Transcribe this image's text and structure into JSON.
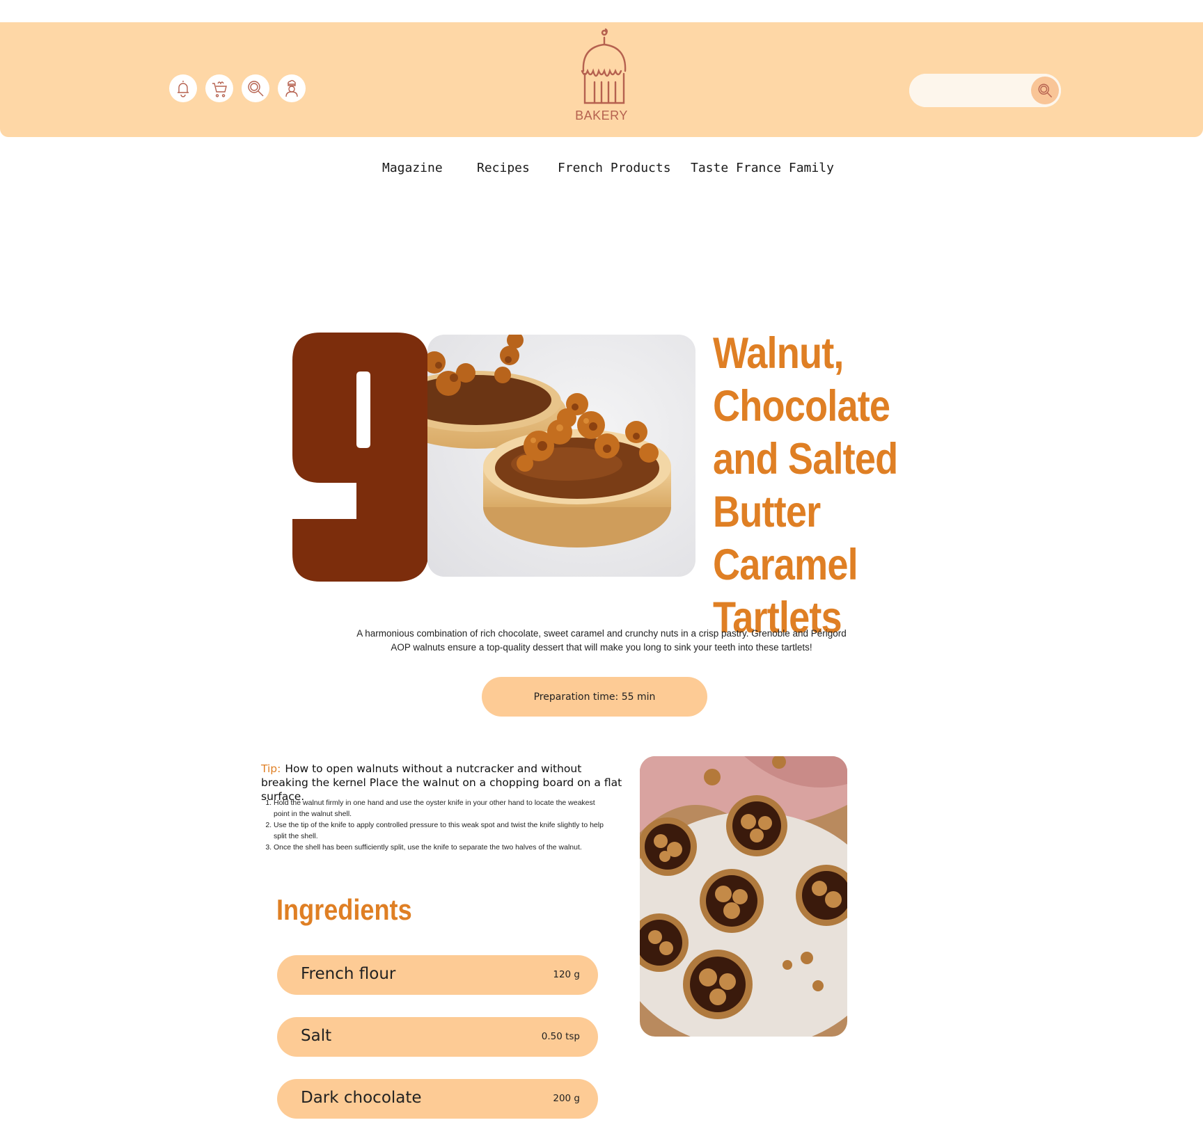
{
  "header": {
    "logo_text": "BAKERY",
    "icons": [
      "bell-icon",
      "cart-icon",
      "search-icon",
      "chef-icon"
    ],
    "search": {
      "placeholder": "",
      "value": ""
    }
  },
  "nav": {
    "items": [
      "Magazine",
      "Recipes",
      "French Products",
      "Taste France Family"
    ]
  },
  "hero": {
    "number": "9",
    "title": "Walnut, Chocolate and Salted Butter Caramel Tartlets",
    "description": "A harmonious combination of rich chocolate, sweet caramel and crunchy nuts in a crisp pastry. Grenoble and Périgord AOP walnuts ensure a top-quality dessert that will make you long to sink your teeth into these tartlets!",
    "prep_time": "Preparation time: 55 min"
  },
  "tip": {
    "label": "Tip:",
    "text": "How to open walnuts without a nutcracker and without breaking the kernel Place the walnut on a chopping board on a flat surface.",
    "steps": [
      "Hold the walnut firmly in one hand and use the oyster knife in your other hand to locate the weakest point in the walnut shell.",
      "Use the tip of the knife to apply controlled pressure to this weak spot and twist the knife slightly to help split the shell.",
      "Once the shell has been sufficiently split, use the knife to separate the two halves of the walnut."
    ]
  },
  "ingredients": {
    "title": "Ingredients",
    "items": [
      {
        "name": "French flour",
        "qty": "120 g"
      },
      {
        "name": "Salt",
        "qty": "0.50 tsp"
      },
      {
        "name": "Dark chocolate",
        "qty": "200 g"
      }
    ]
  },
  "colors": {
    "header_bg": "#fed7a6",
    "pill_bg": "#fdcb95",
    "accent_orange": "#df7f24",
    "number_brown": "#7c2d0c",
    "icon_stroke": "#b5614f"
  }
}
